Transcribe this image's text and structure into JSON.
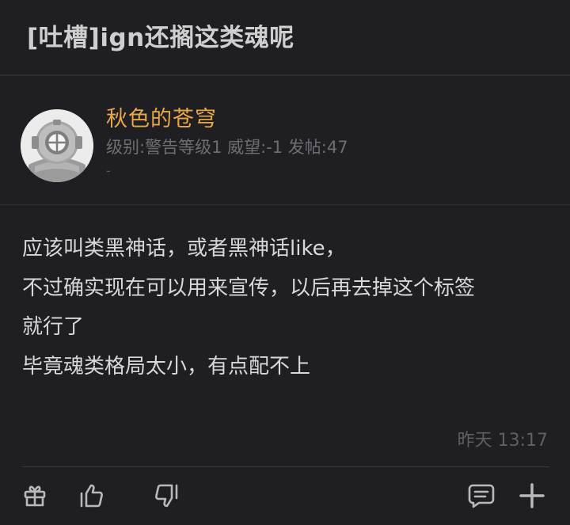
{
  "thread": {
    "title": "[吐槽]ign还搁这类魂呢"
  },
  "author": {
    "name": "秋色的苍穹",
    "meta": "级别:警告等级1 威望:-1 发帖:47",
    "extra": "-",
    "avatar_icon": "diving-helmet-avatar"
  },
  "post": {
    "lines": [
      "应该叫类黑神话，或者黑神话like，",
      "不过确实现在可以用来宣传，以后再去掉这个标签",
      "就行了",
      "毕竟魂类格局太小，有点配不上"
    ],
    "timestamp": "昨天 13:17"
  },
  "actions": {
    "gift_icon": "gift-icon",
    "like_icon": "thumbs-up-icon",
    "dislike_icon": "thumbs-down-icon",
    "comment_icon": "comment-icon",
    "more_icon": "plus-icon"
  },
  "colors": {
    "background": "#1f1f23",
    "username": "#e8a84a",
    "text": "#d8d8d8",
    "muted": "#6d6d72"
  }
}
